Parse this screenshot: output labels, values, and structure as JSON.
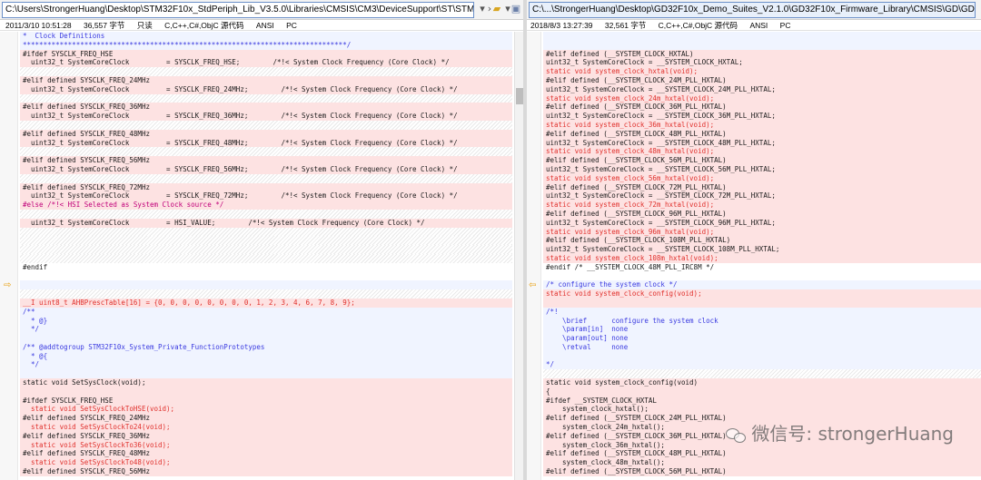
{
  "left": {
    "path": "C:\\Users\\StrongerHuang\\Desktop\\STM32F10x_StdPeriph_Lib_V3.5.0\\Libraries\\CMSIS\\CM3\\DeviceSupport\\ST\\STM32F10x\\system_stm32f10x.c",
    "status": [
      "2011/3/10 10:51:28",
      "36,557 字节",
      "只读",
      "C,C++,C#,ObjC 源代码",
      "ANSI",
      "PC"
    ],
    "lines": [
      {
        "t": "*  Clock Definitions",
        "k": "cur",
        "c": "c-blue"
      },
      {
        "t": "*******************************************************************************/",
        "k": "cur",
        "c": "c-blue"
      },
      {
        "t": "#ifdef SYSCLK_FREQ_HSE",
        "k": "diff",
        "c": "c-pp"
      },
      {
        "t": "  uint32_t SystemCoreClock         = SYSCLK_FREQ_HSE;        /*!< System Clock Frequency (Core Clock) */",
        "k": "diff",
        "c": "c-pp"
      },
      {
        "t": "",
        "k": "blank"
      },
      {
        "t": "#elif defined SYSCLK_FREQ_24MHz",
        "k": "diff",
        "c": "c-pp"
      },
      {
        "t": "  uint32_t SystemCoreClock         = SYSCLK_FREQ_24MHz;        /*!< System Clock Frequency (Core Clock) */",
        "k": "diff",
        "c": "c-pp"
      },
      {
        "t": "",
        "k": "blank"
      },
      {
        "t": "#elif defined SYSCLK_FREQ_36MHz",
        "k": "diff",
        "c": "c-pp"
      },
      {
        "t": "  uint32_t SystemCoreClock         = SYSCLK_FREQ_36MHz;        /*!< System Clock Frequency (Core Clock) */",
        "k": "diff",
        "c": "c-pp"
      },
      {
        "t": "",
        "k": "blank"
      },
      {
        "t": "#elif defined SYSCLK_FREQ_48MHz",
        "k": "diff",
        "c": "c-pp"
      },
      {
        "t": "  uint32_t SystemCoreClock         = SYSCLK_FREQ_48MHz;        /*!< System Clock Frequency (Core Clock) */",
        "k": "diff",
        "c": "c-pp"
      },
      {
        "t": "",
        "k": "blank"
      },
      {
        "t": "#elif defined SYSCLK_FREQ_56MHz",
        "k": "diff",
        "c": "c-pp"
      },
      {
        "t": "  uint32_t SystemCoreClock         = SYSCLK_FREQ_56MHz;        /*!< System Clock Frequency (Core Clock) */",
        "k": "diff",
        "c": "c-pp"
      },
      {
        "t": "",
        "k": "blank"
      },
      {
        "t": "#elif defined SYSCLK_FREQ_72MHz",
        "k": "diff",
        "c": "c-pp"
      },
      {
        "t": "  uint32_t SystemCoreClock         = SYSCLK_FREQ_72MHz;        /*!< System Clock Frequency (Core Clock) */",
        "k": "diff",
        "c": "c-pp"
      },
      {
        "t": "#else /*!< HSI Selected as System Clock source */",
        "k": "diff",
        "c": "c-mag"
      },
      {
        "t": "",
        "k": "blank"
      },
      {
        "t": "  uint32_t SystemCoreClock         = HSI_VALUE;        /*!< System Clock Frequency (Core Clock) */",
        "k": "diff",
        "c": "c-pp"
      },
      {
        "t": "",
        "k": "blank"
      },
      {
        "t": "",
        "k": "blank"
      },
      {
        "t": "",
        "k": "blank"
      },
      {
        "t": "",
        "k": "blank"
      },
      {
        "t": "#endif",
        "k": "gap",
        "c": "c-pp"
      },
      {
        "t": "",
        "k": "gap"
      },
      {
        "t": "",
        "k": "cur"
      },
      {
        "t": "",
        "k": "blank"
      },
      {
        "t": "__I uint8_t AHBPrescTable[16] = {0, 0, 0, 0, 0, 0, 0, 0, 1, 2, 3, 4, 6, 7, 8, 9};",
        "k": "diff",
        "c": "c-red"
      },
      {
        "t": "/**",
        "k": "cur",
        "c": "c-blue"
      },
      {
        "t": "  * @}",
        "k": "cur",
        "c": "c-blue"
      },
      {
        "t": "  */",
        "k": "cur",
        "c": "c-blue"
      },
      {
        "t": "",
        "k": "cur"
      },
      {
        "t": "/** @addtogroup STM32F10x_System_Private_FunctionPrototypes",
        "k": "cur",
        "c": "c-blue"
      },
      {
        "t": "  * @{",
        "k": "cur",
        "c": "c-blue"
      },
      {
        "t": "  */",
        "k": "cur",
        "c": "c-blue"
      },
      {
        "t": "",
        "k": "cur"
      },
      {
        "t": "static void SetSysClock(void);",
        "k": "diff",
        "c": "c-pp"
      },
      {
        "t": "",
        "k": "diff"
      },
      {
        "t": "#ifdef SYSCLK_FREQ_HSE",
        "k": "diff",
        "c": "c-pp"
      },
      {
        "t": "  static void SetSysClockToHSE(void);",
        "k": "diff",
        "c": "c-red"
      },
      {
        "t": "#elif defined SYSCLK_FREQ_24MHz",
        "k": "diff",
        "c": "c-pp"
      },
      {
        "t": "  static void SetSysClockTo24(void);",
        "k": "diff",
        "c": "c-red"
      },
      {
        "t": "#elif defined SYSCLK_FREQ_36MHz",
        "k": "diff",
        "c": "c-pp"
      },
      {
        "t": "  static void SetSysClockTo36(void);",
        "k": "diff",
        "c": "c-red"
      },
      {
        "t": "#elif defined SYSCLK_FREQ_48MHz",
        "k": "diff",
        "c": "c-pp"
      },
      {
        "t": "  static void SetSysClockTo48(void);",
        "k": "diff",
        "c": "c-red"
      },
      {
        "t": "#elif defined SYSCLK_FREQ_56MHz",
        "k": "diff",
        "c": "c-pp"
      }
    ]
  },
  "right": {
    "path": "C:\\...\\StrongerHuang\\Desktop\\GD32F10x_Demo_Suites_V2.1.0\\GD32F10x_Firmware_Library\\CMSIS\\GD\\GD32F10x\\Source\\system_gd32f10x.c",
    "status": [
      "2018/8/3 13:27:39",
      "32,561 字节",
      "C,C++,C#,ObjC 源代码",
      "ANSI",
      "PC"
    ],
    "lines": [
      {
        "t": "",
        "k": "cur"
      },
      {
        "t": "",
        "k": "cur"
      },
      {
        "t": "#elif defined (__SYSTEM_CLOCK_HXTAL)",
        "k": "diff",
        "c": "c-pp"
      },
      {
        "t": "uint32_t SystemCoreClock = __SYSTEM_CLOCK_HXTAL;",
        "k": "diff",
        "c": "c-pp"
      },
      {
        "t": "static void system_clock_hxtal(void);",
        "k": "diff",
        "c": "c-red"
      },
      {
        "t": "#elif defined (__SYSTEM_CLOCK_24M_PLL_HXTAL)",
        "k": "diff",
        "c": "c-pp"
      },
      {
        "t": "uint32_t SystemCoreClock = __SYSTEM_CLOCK_24M_PLL_HXTAL;",
        "k": "diff",
        "c": "c-pp"
      },
      {
        "t": "static void system_clock_24m_hxtal(void);",
        "k": "diff",
        "c": "c-red"
      },
      {
        "t": "#elif defined (__SYSTEM_CLOCK_36M_PLL_HXTAL)",
        "k": "diff",
        "c": "c-pp"
      },
      {
        "t": "uint32_t SystemCoreClock = __SYSTEM_CLOCK_36M_PLL_HXTAL;",
        "k": "diff",
        "c": "c-pp"
      },
      {
        "t": "static void system_clock_36m_hxtal(void);",
        "k": "diff",
        "c": "c-red"
      },
      {
        "t": "#elif defined (__SYSTEM_CLOCK_48M_PLL_HXTAL)",
        "k": "diff",
        "c": "c-pp"
      },
      {
        "t": "uint32_t SystemCoreClock = __SYSTEM_CLOCK_48M_PLL_HXTAL;",
        "k": "diff",
        "c": "c-pp"
      },
      {
        "t": "static void system_clock_48m_hxtal(void);",
        "k": "diff",
        "c": "c-red"
      },
      {
        "t": "#elif defined (__SYSTEM_CLOCK_56M_PLL_HXTAL)",
        "k": "diff",
        "c": "c-pp"
      },
      {
        "t": "uint32_t SystemCoreClock = __SYSTEM_CLOCK_56M_PLL_HXTAL;",
        "k": "diff",
        "c": "c-pp"
      },
      {
        "t": "static void system_clock_56m_hxtal(void);",
        "k": "diff",
        "c": "c-red"
      },
      {
        "t": "#elif defined (__SYSTEM_CLOCK_72M_PLL_HXTAL)",
        "k": "diff",
        "c": "c-pp"
      },
      {
        "t": "uint32_t SystemCoreClock = __SYSTEM_CLOCK_72M_PLL_HXTAL;",
        "k": "diff",
        "c": "c-pp"
      },
      {
        "t": "static void system_clock_72m_hxtal(void);",
        "k": "diff",
        "c": "c-red"
      },
      {
        "t": "#elif defined (__SYSTEM_CLOCK_96M_PLL_HXTAL)",
        "k": "diff",
        "c": "c-pp"
      },
      {
        "t": "uint32_t SystemCoreClock = __SYSTEM_CLOCK_96M_PLL_HXTAL;",
        "k": "diff",
        "c": "c-pp"
      },
      {
        "t": "static void system_clock_96m_hxtal(void);",
        "k": "diff",
        "c": "c-red"
      },
      {
        "t": "#elif defined (__SYSTEM_CLOCK_108M_PLL_HXTAL)",
        "k": "diff",
        "c": "c-pp"
      },
      {
        "t": "uint32_t SystemCoreClock = __SYSTEM_CLOCK_108M_PLL_HXTAL;",
        "k": "diff",
        "c": "c-pp"
      },
      {
        "t": "static void system_clock_108m_hxtal(void);",
        "k": "diff",
        "c": "c-red"
      },
      {
        "t": "#endif /* __SYSTEM_CLOCK_48M_PLL_IRC8M */",
        "k": "gap",
        "c": "c-pp"
      },
      {
        "t": "",
        "k": "gap"
      },
      {
        "t": "/* configure the system clock */",
        "k": "cur",
        "c": "c-blue"
      },
      {
        "t": "static void system_clock_config(void);",
        "k": "diff",
        "c": "c-red"
      },
      {
        "t": "",
        "k": "diff"
      },
      {
        "t": "/*!",
        "k": "cur",
        "c": "c-blue"
      },
      {
        "t": "    \\brief      configure the system clock",
        "k": "cur",
        "c": "c-blue"
      },
      {
        "t": "    \\param[in]  none",
        "k": "cur",
        "c": "c-blue"
      },
      {
        "t": "    \\param[out] none",
        "k": "cur",
        "c": "c-blue"
      },
      {
        "t": "    \\retval     none",
        "k": "cur",
        "c": "c-blue"
      },
      {
        "t": "",
        "k": "cur"
      },
      {
        "t": "*/",
        "k": "cur",
        "c": "c-blue"
      },
      {
        "t": "",
        "k": "blank"
      },
      {
        "t": "static void system_clock_config(void)",
        "k": "diff",
        "c": "c-pp"
      },
      {
        "t": "{",
        "k": "diff",
        "c": "c-pp"
      },
      {
        "t": "#ifdef __SYSTEM_CLOCK_HXTAL",
        "k": "diff",
        "c": "c-pp"
      },
      {
        "t": "    system_clock_hxtal();",
        "k": "diff",
        "c": "c-pp"
      },
      {
        "t": "#elif defined (__SYSTEM_CLOCK_24M_PLL_HXTAL)",
        "k": "diff",
        "c": "c-pp"
      },
      {
        "t": "    system_clock_24m_hxtal();",
        "k": "diff",
        "c": "c-pp"
      },
      {
        "t": "#elif defined (__SYSTEM_CLOCK_36M_PLL_HXTAL)",
        "k": "diff",
        "c": "c-pp"
      },
      {
        "t": "    system_clock_36m_hxtal();",
        "k": "diff",
        "c": "c-pp"
      },
      {
        "t": "#elif defined (__SYSTEM_CLOCK_48M_PLL_HXTAL)",
        "k": "diff",
        "c": "c-pp"
      },
      {
        "t": "    system_clock_48m_hxtal();",
        "k": "diff",
        "c": "c-pp"
      },
      {
        "t": "#elif defined (__SYSTEM_CLOCK_56M_PLL_HXTAL)",
        "k": "diff",
        "c": "c-pp"
      }
    ]
  },
  "watermark": {
    "text": "微信号: strongerHuang"
  },
  "icons": {
    "dropdown": "chevron-down-icon",
    "forward": "chevron-right-icon",
    "folder": "folder-icon",
    "save": "save-icon",
    "marker": "arrow-marker-icon"
  },
  "colors": {
    "diff_bg": "#fde2e2",
    "keyword_red": "#e0302c",
    "comment_blue": "#3a3ae0",
    "current_bg": "#f0f4ff"
  }
}
